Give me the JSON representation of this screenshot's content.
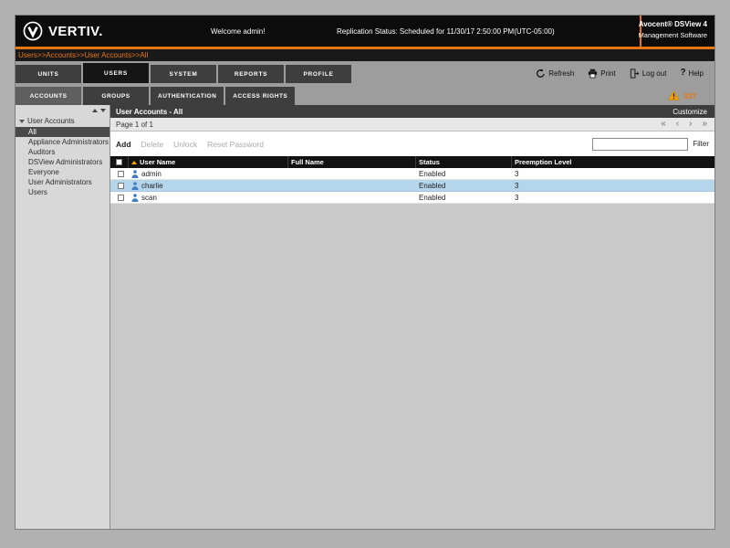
{
  "window": {
    "header": {
      "brand": "VERTIV.",
      "welcome": "Welcome admin!",
      "replication_status": "Replication Status: Scheduled for 11/30/17 2:50:00 PM(UTC-05:00)",
      "product_line1": "Avocent® DSView 4",
      "product_line2": "Management Software"
    },
    "breadcrumb": "Users>>Accounts>>User Accounts>>All",
    "main_tabs": [
      {
        "label": "UNITS",
        "selected": false
      },
      {
        "label": "USERS",
        "selected": true
      },
      {
        "label": "SYSTEM",
        "selected": false
      },
      {
        "label": "REPORTS",
        "selected": false
      },
      {
        "label": "PROFILE",
        "selected": false
      }
    ],
    "utilities": [
      {
        "label": "Refresh",
        "icon": "refresh-icon"
      },
      {
        "label": "Print",
        "icon": "print-icon"
      },
      {
        "label": "Log out",
        "icon": "logout-icon"
      },
      {
        "label": "Help",
        "icon": "help-icon",
        "glyph": "?"
      }
    ],
    "sub_tabs": [
      {
        "label": "ACCOUNTS",
        "selected": true
      },
      {
        "label": "GROUPS",
        "selected": false
      },
      {
        "label": "AUTHENTICATION",
        "selected": false
      },
      {
        "label": "ACCESS RIGHTS",
        "selected": false
      }
    ],
    "alert_count": "337",
    "sidebar": {
      "root": "User Accounts",
      "items": [
        {
          "label": "All",
          "selected": true
        },
        {
          "label": "Appliance Administrators",
          "selected": false
        },
        {
          "label": "Auditors",
          "selected": false
        },
        {
          "label": "DSView Administrators",
          "selected": false
        },
        {
          "label": "Everyone",
          "selected": false
        },
        {
          "label": "User Administrators",
          "selected": false
        },
        {
          "label": "Users",
          "selected": false
        }
      ]
    },
    "main": {
      "title": "User Accounts - All",
      "customize": "Customize",
      "page_info": "Page 1 of 1",
      "pagination": [
        "«",
        "‹",
        "›",
        "»"
      ],
      "toolbar": {
        "add": "Add",
        "delete": "Delete",
        "unlock": "Unlock",
        "reset_password": "Reset Password",
        "filter_label": "Filter",
        "filter_value": ""
      },
      "table": {
        "columns": [
          "User Name",
          "Full Name",
          "Status",
          "Preemption Level"
        ],
        "rows": [
          {
            "user_name": "admin",
            "full_name": "",
            "status": "Enabled",
            "preemption_level": "3",
            "selected": false
          },
          {
            "user_name": "charlie",
            "full_name": "",
            "status": "Enabled",
            "preemption_level": "3",
            "selected": true
          },
          {
            "user_name": "scan",
            "full_name": "",
            "status": "Enabled",
            "preemption_level": "3",
            "selected": false
          }
        ]
      }
    },
    "colors": {
      "accent_orange": "#e87511",
      "selected_row_blue": "#b5d5eb",
      "warning_yellow": "#f2a007"
    }
  }
}
